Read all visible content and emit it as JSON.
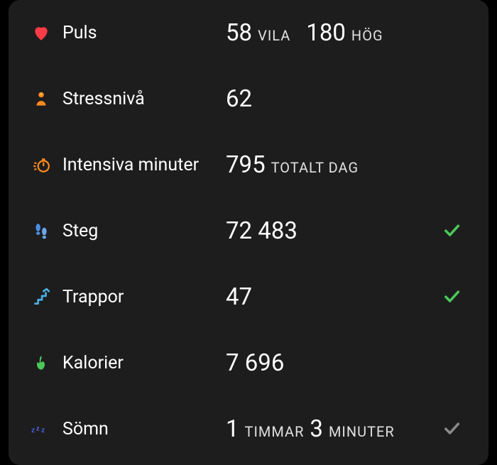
{
  "stats": {
    "pulse": {
      "label": "Puls",
      "resting_value": "58",
      "resting_label": "VILA",
      "high_value": "180",
      "high_label": "HÖG"
    },
    "stress": {
      "label": "Stressnivå",
      "value": "62"
    },
    "intensity": {
      "label": "Intensiva minuter",
      "value": "795",
      "unit": "TOTALT DAG"
    },
    "steps": {
      "label": "Steg",
      "value": "72 483",
      "achieved": true
    },
    "floors": {
      "label": "Trappor",
      "value": "47",
      "achieved": true
    },
    "calories": {
      "label": "Kalorier",
      "value": "7 696"
    },
    "sleep": {
      "label": "Sömn",
      "hours_value": "1",
      "hours_label": "TIMMAR",
      "minutes_value": "3",
      "minutes_label": "MINUTER",
      "achieved": false
    }
  },
  "colors": {
    "heart": "#ff3b47",
    "stress": "#ff8a1f",
    "intensity": "#ff8a1f",
    "steps": "#4a8de0",
    "floors": "#4aaee0",
    "calories": "#4ac95a",
    "sleep": "#4a5ee0",
    "check_green": "#4ac95a",
    "check_gray": "#8a8a8a"
  }
}
